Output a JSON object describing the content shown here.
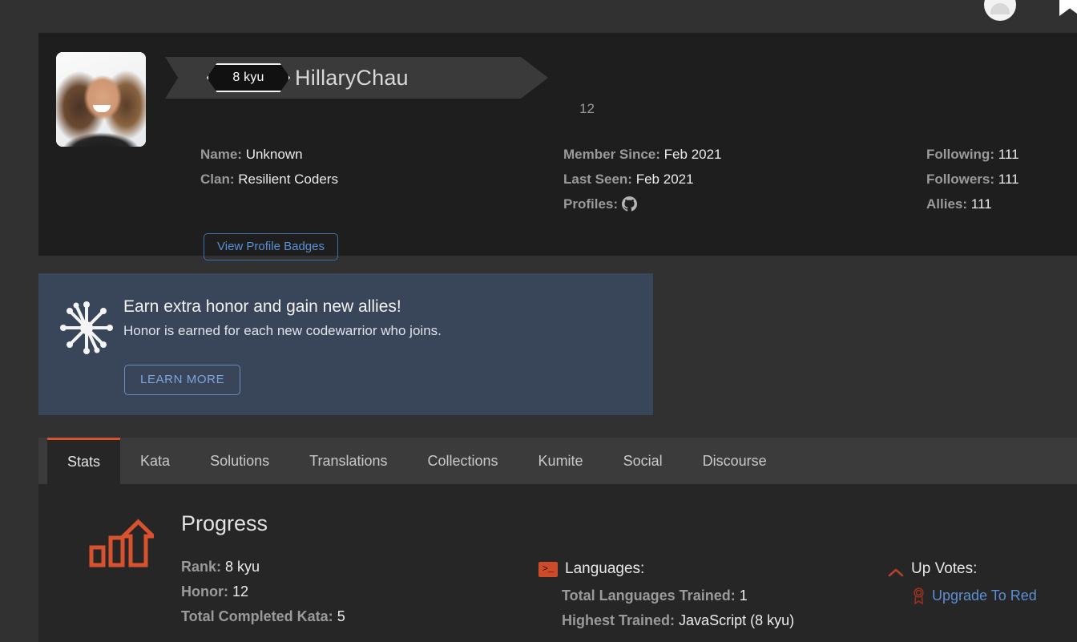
{
  "topbar": {
    "avatar_icon": "user-avatar-icon",
    "bookmark_icon": "bookmark-flag-icon"
  },
  "profile": {
    "avatar_alt": "HillaryChau profile photo",
    "rank": "8 kyu",
    "username": "HillaryChau",
    "honor_points": "12",
    "left_column": [
      {
        "label": "Name:",
        "value": "Unknown"
      },
      {
        "label": "Clan:",
        "value": "Resilient Coders"
      }
    ],
    "middle_column": [
      {
        "label": "Member Since:",
        "value": "Feb 2021"
      },
      {
        "label": "Last Seen:",
        "value": "Feb 2021"
      },
      {
        "label": "Profiles:",
        "value": "",
        "icon": "github-icon"
      }
    ],
    "right_column": [
      {
        "label": "Following:",
        "value": "111"
      },
      {
        "label": "Followers:",
        "value": "111"
      },
      {
        "label": "Allies:",
        "value": "111"
      }
    ],
    "badges_button": "View Profile Badges"
  },
  "promo": {
    "icon": "honor-burst-icon",
    "title": "Earn extra honor and gain new allies!",
    "subtitle": "Honor is earned for each new codewarrior who joins.",
    "button": "LEARN MORE"
  },
  "tabs": [
    {
      "label": "Stats",
      "active": true
    },
    {
      "label": "Kata",
      "active": false
    },
    {
      "label": "Solutions",
      "active": false
    },
    {
      "label": "Translations",
      "active": false
    },
    {
      "label": "Collections",
      "active": false
    },
    {
      "label": "Kumite",
      "active": false
    },
    {
      "label": "Social",
      "active": false
    },
    {
      "label": "Discourse",
      "active": false
    }
  ],
  "stats": {
    "progress": {
      "icon": "progress-bar-chart-icon",
      "title": "Progress",
      "rows": [
        {
          "label": "Rank:",
          "value": "8 kyu"
        },
        {
          "label": "Honor:",
          "value": "12"
        },
        {
          "label": "Total Completed Kata:",
          "value": "5"
        }
      ]
    },
    "languages": {
      "icon": "terminal-icon",
      "heading": "Languages:",
      "rows": [
        {
          "label": "Total Languages Trained:",
          "value": "1"
        },
        {
          "label": "Highest Trained:",
          "value": "JavaScript (8 kyu)"
        }
      ]
    },
    "upvotes": {
      "icon": "chevron-up-icon",
      "heading": "Up Votes:",
      "link_icon": "medal-ribbon-icon",
      "link_label": "Upgrade To Red"
    }
  },
  "colors": {
    "page_bg": "#313131",
    "card_bg": "#1e1e1e",
    "promo_bg": "#39465a",
    "tabstrip_bg": "#3b3b3b",
    "stats_bg": "#262626",
    "accent_orange": "#d9522e",
    "link_blue": "#5b8fd4",
    "label_gray": "#9a9a9a"
  }
}
